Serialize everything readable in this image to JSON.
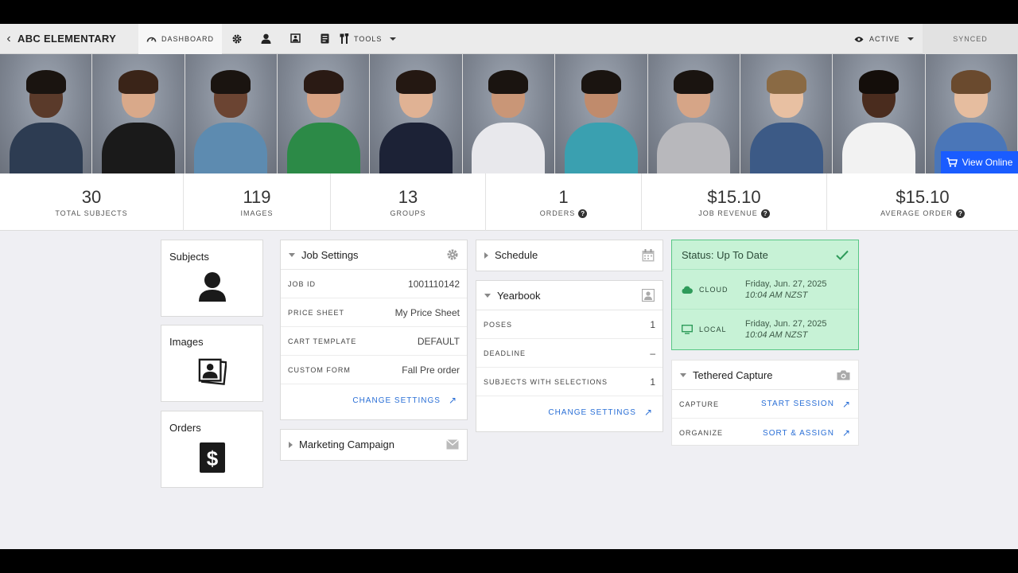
{
  "topbar": {
    "school_name": "ABC ELEMENTARY",
    "dashboard_label": "DASHBOARD",
    "tools_label": "TOOLS",
    "active_label": "ACTIVE",
    "synced_label": "SYNCED"
  },
  "photo_strip": {
    "view_online_label": "View Online",
    "photos": [
      {
        "skin": "#5a3a2a",
        "hair": "#1a1410",
        "shirt": "#2d3c52"
      },
      {
        "skin": "#d9a98a",
        "hair": "#3a2418",
        "shirt": "#1a1a1a"
      },
      {
        "skin": "#6b4432",
        "hair": "#1a1410",
        "shirt": "#5d8bb0"
      },
      {
        "skin": "#d8a384",
        "hair": "#2a1a14",
        "shirt": "#2c8a47"
      },
      {
        "skin": "#e0b294",
        "hair": "#241812",
        "shirt": "#1c2236"
      },
      {
        "skin": "#c99677",
        "hair": "#1a1410",
        "shirt": "#e8e8ec"
      },
      {
        "skin": "#c08b6c",
        "hair": "#1a1410",
        "shirt": "#3aa0b0"
      },
      {
        "skin": "#d6a587",
        "hair": "#1a1410",
        "shirt": "#b8b8bc"
      },
      {
        "skin": "#e8c0a2",
        "hair": "#8a6a44",
        "shirt": "#3c5a86"
      },
      {
        "skin": "#4a2c1e",
        "hair": "#140e0a",
        "shirt": "#f2f2f2"
      },
      {
        "skin": "#e6bd9f",
        "hair": "#6a4a2e",
        "shirt": "#4a76b8"
      }
    ]
  },
  "stats": [
    {
      "value": "30",
      "label": "TOTAL SUBJECTS",
      "help": false
    },
    {
      "value": "119",
      "label": "IMAGES",
      "help": false
    },
    {
      "value": "13",
      "label": "GROUPS",
      "help": false
    },
    {
      "value": "1",
      "label": "ORDERS",
      "help": true
    },
    {
      "value": "$15.10",
      "label": "JOB REVENUE",
      "help": true
    },
    {
      "value": "$15.10",
      "label": "AVERAGE ORDER",
      "help": true
    }
  ],
  "side_cards": {
    "subjects": "Subjects",
    "images": "Images",
    "orders": "Orders"
  },
  "job_settings": {
    "title": "Job Settings",
    "rows": [
      {
        "key": "JOB ID",
        "value": "1001110142"
      },
      {
        "key": "PRICE SHEET",
        "value": "My Price Sheet"
      },
      {
        "key": "CART TEMPLATE",
        "value": "DEFAULT"
      },
      {
        "key": "CUSTOM FORM",
        "value": "Fall Pre order"
      }
    ],
    "change_label": "CHANGE SETTINGS"
  },
  "marketing": {
    "title": "Marketing Campaign"
  },
  "schedule": {
    "title": "Schedule"
  },
  "yearbook": {
    "title": "Yearbook",
    "rows": [
      {
        "key": "POSES",
        "value": "1"
      },
      {
        "key": "DEADLINE",
        "value": "–"
      },
      {
        "key": "SUBJECTS WITH SELECTIONS",
        "value": "1"
      }
    ],
    "change_label": "CHANGE SETTINGS"
  },
  "status": {
    "title": "Status: Up To Date",
    "rows": [
      {
        "key": "CLOUD",
        "date": "Friday, Jun. 27, 2025",
        "time": "10:04 AM NZST"
      },
      {
        "key": "LOCAL",
        "date": "Friday, Jun. 27, 2025",
        "time": "10:04 AM NZST"
      }
    ]
  },
  "tethered": {
    "title": "Tethered Capture",
    "capture_key": "CAPTURE",
    "capture_action": "START SESSION",
    "organize_key": "ORGANIZE",
    "organize_action": "SORT & ASSIGN"
  },
  "colors": {
    "accent": "#1a5cff",
    "link": "#2a6fd6",
    "status_bg": "#c7f2d6",
    "status_border": "#57c684"
  }
}
